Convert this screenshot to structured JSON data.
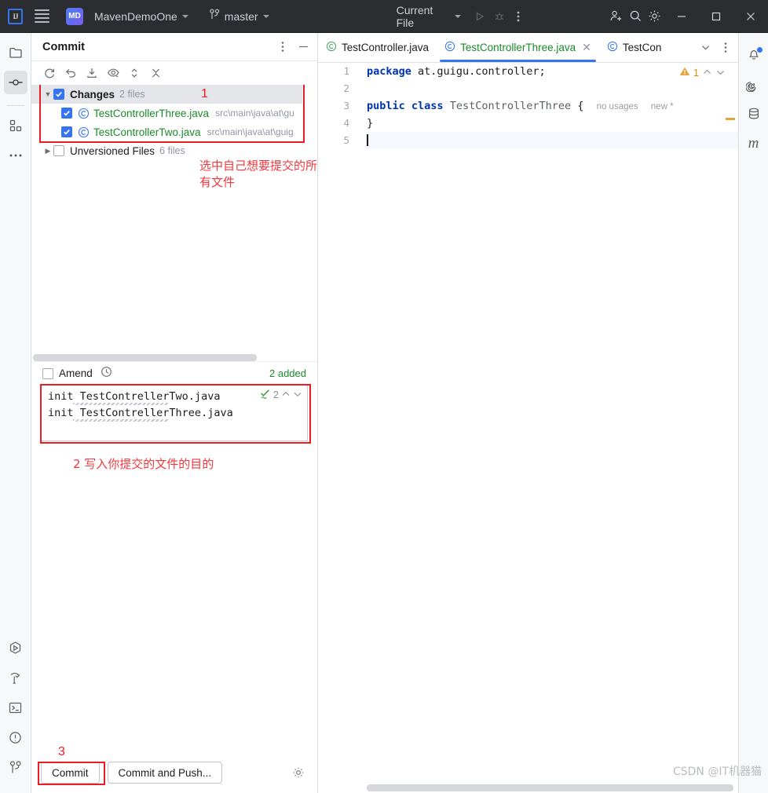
{
  "titlebar": {
    "logo": "IJ",
    "menu_icon": "hamburger-menu-icon",
    "project_badge": "MD",
    "project_name": "MavenDemoOne",
    "branch_icon": "git-branch-icon",
    "branch_name": "master",
    "run_config": "Current File",
    "run_icon": "run-icon",
    "debug_icon": "debug-icon",
    "more_icon": "more-vertical-icon",
    "share_icon": "add-user-icon",
    "search_icon": "search-icon",
    "settings_icon": "gear-icon",
    "minimize": "minimize-icon",
    "maximize": "maximize-icon",
    "close": "close-icon"
  },
  "left_rail": {
    "items": [
      {
        "name": "project-tool-icon",
        "label": "Project",
        "active": false
      },
      {
        "name": "commit-tool-icon",
        "label": "Commit",
        "active": true
      },
      {
        "name": "structure-tool-icon",
        "label": "Structure",
        "active": false
      },
      {
        "name": "more-tools-icon",
        "label": "More Tool Windows",
        "active": false
      }
    ],
    "bottom_items": [
      {
        "name": "run-tool-icon",
        "label": "Run"
      },
      {
        "name": "build-tool-icon",
        "label": "Build"
      },
      {
        "name": "terminal-tool-icon",
        "label": "Terminal"
      },
      {
        "name": "problems-tool-icon",
        "label": "Problems"
      },
      {
        "name": "git-tool-icon",
        "label": "Git"
      }
    ]
  },
  "right_rail": {
    "items": [
      {
        "name": "notifications-icon",
        "label": "Notifications",
        "badge": true
      },
      {
        "name": "ai-assistant-icon",
        "label": "AI Assistant",
        "badge": false
      },
      {
        "name": "database-icon",
        "label": "Database",
        "badge": false
      },
      {
        "name": "maven-icon",
        "label": "Maven",
        "badge": false
      }
    ]
  },
  "commit_panel": {
    "title": "Commit",
    "header_actions": [
      {
        "name": "options-icon",
        "label": "Options"
      },
      {
        "name": "hide-icon",
        "label": "Hide"
      }
    ],
    "toolbar": [
      {
        "name": "refresh-icon",
        "label": "Refresh Changes"
      },
      {
        "name": "rollback-icon",
        "label": "Rollback"
      },
      {
        "name": "update-project-icon",
        "label": "Update Project"
      },
      {
        "name": "show-diff-icon",
        "label": "Show Diff Preview"
      },
      {
        "name": "expand-collapse-icon",
        "label": "Expand or Collapse"
      },
      {
        "name": "collapse-all-icon",
        "label": "Collapse All"
      }
    ],
    "tree": [
      {
        "type": "group",
        "label": "Changes",
        "count": "2 files",
        "checked": true,
        "expanded": true,
        "selected": true
      },
      {
        "type": "file",
        "name": "TestControllerThree.java",
        "path": "src\\main\\java\\at\\gu",
        "checked": true,
        "icon": "java-class-icon"
      },
      {
        "type": "file",
        "name": "TestControllerTwo.java",
        "path": "src\\main\\java\\at\\guig",
        "checked": true,
        "icon": "java-class-icon"
      },
      {
        "type": "group",
        "label": "Unversioned Files",
        "count": "6 files",
        "checked": false,
        "expanded": false,
        "selected": false
      }
    ],
    "amend": {
      "label": "Amend",
      "checked": false,
      "history_icon": "history-clock-icon"
    },
    "added_status": "2 added",
    "message": {
      "line1": "init TestContrellerTwo.java",
      "line2": "init TestContrellerThree.java",
      "spellcheck_icon": "spellcheck-ok-icon",
      "spellcheck_count": "2",
      "prev_icon": "chevron-up-icon",
      "next_icon": "chevron-down-icon"
    },
    "buttons": {
      "commit": "Commit",
      "commit_and_push": "Commit and Push...",
      "settings_icon": "gear-icon"
    }
  },
  "annotations": {
    "marker1": "1",
    "note1": "选中自己想要提交的所有文件",
    "note2": "2 写入你提交的文件的目的",
    "marker3": "3",
    "accent_color": "#ec1c24"
  },
  "editor": {
    "tabs": [
      {
        "label": "TestController.java",
        "icon": "java-class-modified-icon",
        "active": false,
        "closable": false
      },
      {
        "label": "TestControllerThree.java",
        "icon": "java-class-icon",
        "active": true,
        "closable": true
      },
      {
        "label": "TestCon",
        "icon": "java-class-icon",
        "active": false,
        "closable": false
      }
    ],
    "tab_actions": [
      {
        "name": "tab-list-chevron-icon",
        "label": "Select Opened File"
      },
      {
        "name": "tab-options-icon",
        "label": "Options"
      }
    ],
    "gutter_lines": [
      "1",
      "2",
      "3",
      "4",
      "5"
    ],
    "code": {
      "line1_kw": "package",
      "line1_rest": "at.guigu.controller;",
      "line3_kw1": "public",
      "line3_kw2": "class",
      "line3_name": "TestControllerThree",
      "line3_brace": "{",
      "line3_hint1": "no usages",
      "line3_hint2": "new *",
      "line4": "}"
    },
    "inspection": {
      "warn_icon": "warning-triangle-icon",
      "warn_count": "1",
      "prev_icon": "chevron-up-icon",
      "next_icon": "chevron-down-icon"
    }
  },
  "watermark": "CSDN @IT机器猫"
}
